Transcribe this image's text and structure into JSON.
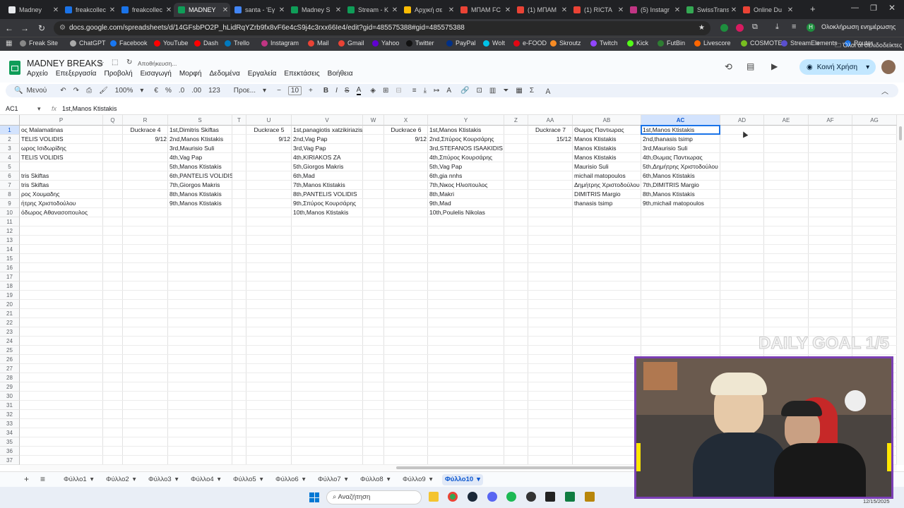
{
  "browser": {
    "tabs": [
      {
        "title": "Madney",
        "color": "#e8eaed"
      },
      {
        "title": "freakcollec",
        "color": "#1a73e8"
      },
      {
        "title": "freakcollec",
        "color": "#1a73e8"
      },
      {
        "title": "MADNEY",
        "color": "#0f9d58",
        "active": true
      },
      {
        "title": "santa - 'Εγ",
        "color": "#4285f4"
      },
      {
        "title": "Madney S",
        "color": "#0f9d58"
      },
      {
        "title": "Stream - K",
        "color": "#0f9d58"
      },
      {
        "title": "Αρχική σε",
        "color": "#fbbc04"
      },
      {
        "title": "ΜΠΑΜ FC",
        "color": "#ea4335"
      },
      {
        "title": "(1) ΜΠΑΜ",
        "color": "#ea4335"
      },
      {
        "title": "(1) RICTA",
        "color": "#ea4335"
      },
      {
        "title": "(5) Instagr",
        "color": "#c13584"
      },
      {
        "title": "SwissTrans",
        "color": "#34a853"
      },
      {
        "title": "Online Du",
        "color": "#ea4335"
      }
    ],
    "url": "docs.google.com/spreadsheets/d/14GFsbPO2P_hLidRqYZrb9fx8vF6e4cS9j4c3rxx66Ie4/edit?gid=485575388#gid=485575388",
    "bookmarks": [
      {
        "label": "Freak Site",
        "color": "#888"
      },
      {
        "label": "ChatGPT",
        "color": "#aaa"
      },
      {
        "label": "Facebook",
        "color": "#1877f2"
      },
      {
        "label": "YouTube",
        "color": "#ff0000"
      },
      {
        "label": "Dash",
        "color": "#ff0000"
      },
      {
        "label": "Trello",
        "color": "#0079bf"
      },
      {
        "label": "Instagram",
        "color": "#c13584"
      },
      {
        "label": "Mail",
        "color": "#ea4335"
      },
      {
        "label": "Gmail",
        "color": "#ea4335"
      },
      {
        "label": "Yahoo",
        "color": "#6001d2"
      },
      {
        "label": "Twitter",
        "color": "#111"
      },
      {
        "label": "PayPal",
        "color": "#003087"
      },
      {
        "label": "Wolt",
        "color": "#00c2e8"
      },
      {
        "label": "e-FOOD",
        "color": "#e30613"
      },
      {
        "label": "Skroutz",
        "color": "#f68b24"
      },
      {
        "label": "Twitch",
        "color": "#9146ff"
      },
      {
        "label": "Kick",
        "color": "#53fc18"
      },
      {
        "label": "FutBin",
        "color": "#2e7d32"
      },
      {
        "label": "Livescore",
        "color": "#ff6600"
      },
      {
        "label": "COSMOTE",
        "color": "#78be20"
      },
      {
        "label": "StreamElements",
        "color": "#5a4fcf"
      },
      {
        "label": "Router",
        "color": "#1a73e8"
      }
    ],
    "all_bookmarks": "Όλοι οι σελιδοδείκτες",
    "update_label": "Ολοκλήρωση ενημέρωσης"
  },
  "doc": {
    "title": "MADNEY BREAKS",
    "saving": "Αποθήκευση...",
    "menus": [
      "Αρχείο",
      "Επεξεργασία",
      "Προβολή",
      "Εισαγωγή",
      "Μορφή",
      "Δεδομένα",
      "Εργαλεία",
      "Επεκτάσεις",
      "Βοήθεια"
    ],
    "share_label": "Κοινή Χρήση",
    "colors": {
      "share_bg": "#c2e7ff",
      "accent": "#1a73e8"
    }
  },
  "toolbar": {
    "menu_label": "Μενού",
    "zoom": "100%",
    "currency": "€",
    "percent": "%",
    "dec_decrease": ".0",
    "dec_increase": ".00",
    "number_format": "123",
    "font": "Προε...",
    "font_size": "10"
  },
  "formula": {
    "cell_ref": "AC1",
    "content": "1st,Manos Ktistakis"
  },
  "grid": {
    "columns": [
      {
        "id": "P",
        "w": 118
      },
      {
        "id": "Q",
        "w": 28
      },
      {
        "id": "R",
        "w": 64
      },
      {
        "id": "S",
        "w": 91
      },
      {
        "id": "T",
        "w": 20
      },
      {
        "id": "U",
        "w": 64
      },
      {
        "id": "V",
        "w": 101
      },
      {
        "id": "W",
        "w": 30
      },
      {
        "id": "X",
        "w": 62
      },
      {
        "id": "Y",
        "w": 108
      },
      {
        "id": "Z",
        "w": 34
      },
      {
        "id": "AA",
        "w": 63
      },
      {
        "id": "AB",
        "w": 97
      },
      {
        "id": "AC",
        "w": 112,
        "selected": true
      },
      {
        "id": "AD",
        "w": 62
      },
      {
        "id": "AE",
        "w": 63
      },
      {
        "id": "AF",
        "w": 62
      },
      {
        "id": "AG",
        "w": 63
      }
    ],
    "row_count": 37,
    "rows": [
      {
        "P": "ος Malamatinas",
        "R": "Duckrace 4",
        "S": "1st,Dimitris Skiftas",
        "U": "Duckrace 5",
        "V": "1st,panagiotis xatzikiriazis",
        "X": "Duckrace 6",
        "Y": "1st,Manos Ktistakis",
        "AA": "Duckrace 7",
        "AB": "Θωμας Παντιωρας",
        "AC": "1st,Manos Ktistakis"
      },
      {
        "P": "ΤELIS VOLIDIS",
        "R": "9/12",
        "S": "2nd,Manos Ktistakis",
        "U": "9/12",
        "V": "2nd,Vag  Pap",
        "X": "9/12",
        "Y": "2nd,Σπύρος Κουρσάρης",
        "AA": "15/12",
        "AB": "Manos Ktistakis",
        "AC": "2nd,thanasis tsimp"
      },
      {
        "P": "ωρος Ισιδωρίδης",
        "S": "3rd,Maurisio Suli",
        "V": "3rd,Vag  Pap",
        "Y": "3rd,STEFANOS ISAAKIDIS",
        "AB": "Manos Ktistakis",
        "AC": "3rd,Maurisio Suli"
      },
      {
        "P": "ΤELIS VOLIDIS",
        "S": "4th,Vag  Pap",
        "V": "4th,KIRIAKOS ZA",
        "Y": "4th,Σπύρος Κουρσάρης",
        "AB": "Manos Ktistakis",
        "AC": "4th,Θωμας Παντιωρας"
      },
      {
        "S": "5th,Manos Ktistakis",
        "V": "5th,Giorgos Makris",
        "Y": "5th,Vag  Pap",
        "AB": "Maurisio Suli",
        "AC": "5th,Δημήτρης  Χριστοδούλου"
      },
      {
        "P": "tris Skiftas",
        "S": "6th,PANTELIS VOLIDIS",
        "V": "6th,Mad",
        "Y": "6th,gia nnhs",
        "AB": "michail matopoulos",
        "AC": "6th,Manos Ktistakis"
      },
      {
        "P": "tris Skiftas",
        "S": "7th,Giorgos Makris",
        "V": "7th,Manos Ktistakis",
        "Y": "7th,Νικος Ηλιοπουλος",
        "AB": "Δημήτρης  Χριστοδούλου",
        "AC": "7th,DIMITRIS Margio"
      },
      {
        "P": "ρος  Χουμαδης",
        "S": "8th,Manos Ktistakis",
        "V": "8th,PANTELIS VOLIDIS",
        "Y": "8th,Makri",
        "AB": "DIMITRIS Margio",
        "AC": "8th,Manos Ktistakis"
      },
      {
        "P": "ήτρης  Χριστοδούλου",
        "S": "9th,Manos Ktistakis",
        "V": "9th,Σπύρος Κουρσάρης",
        "Y": "9th,Mad",
        "AB": "thanasis tsimp",
        "AC": "9th,michail matopoulos"
      },
      {
        "P": "όδωρος  Αθανασοπουλος",
        "V": "10th,Manos Ktistakis",
        "Y": "10th,Poulelis Nikolas"
      }
    ],
    "number_cols": [
      "R",
      "U",
      "X",
      "AA"
    ]
  },
  "sheets": [
    "Φύλλο1",
    "Φύλλο2",
    "Φύλλο3",
    "Φύλλο4",
    "Φύλλο5",
    "Φύλλο6",
    "Φύλλο7",
    "Φύλλο8",
    "Φύλλο9",
    "Φύλλο10"
  ],
  "active_sheet": "Φύλλο10",
  "overlay": {
    "daily_goal": "DAILY GOAL 1/5"
  },
  "taskbar": {
    "search_placeholder": "Αναζήτηση",
    "date": "12/15/2025"
  }
}
